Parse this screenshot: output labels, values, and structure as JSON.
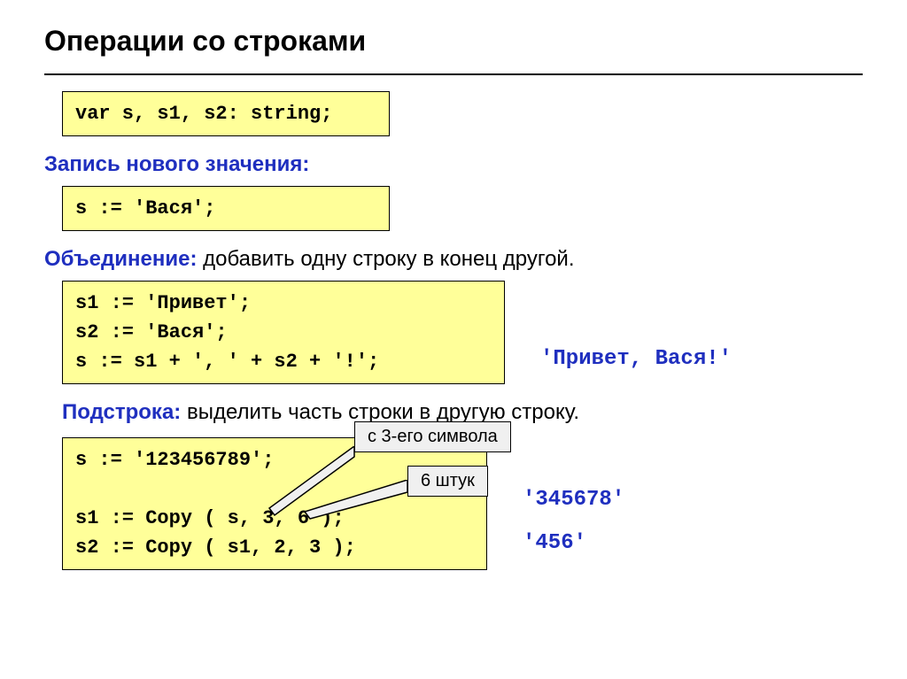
{
  "title": "Операции со строками",
  "declaration": "var s, s1, s2: string;",
  "sections": {
    "assign": {
      "label": "Запись нового значения:",
      "code": "s := 'Вася';"
    },
    "concat": {
      "label": "Объединение:",
      "rest": " добавить одну строку в конец другой.",
      "code": "s1 := 'Привет';\ns2 := 'Вася';\ns := s1 + ', ' + s2 + '!';",
      "result": "'Привет, Вася!'"
    },
    "substr": {
      "label": "Подстрока:",
      "rest": " выделить часть строки в другую строку.",
      "code": "s := '123456789';\n\ns1 := Copy ( s, 3, 6 );\ns2 := Copy ( s1, 2, 3 );",
      "callout1": "с 3-его символа",
      "callout2": "6 штук",
      "result1": "'345678'",
      "result2": "'456'"
    }
  }
}
